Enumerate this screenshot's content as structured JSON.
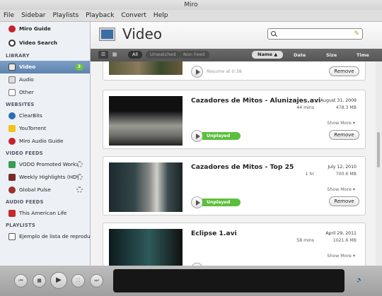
{
  "window": {
    "title": "Miro"
  },
  "menu": [
    "File",
    "Sidebar",
    "Playlists",
    "Playback",
    "Convert",
    "Help"
  ],
  "sidebar": {
    "top": [
      {
        "label": "Miro Guide",
        "icon": "miro-logo-icon"
      },
      {
        "label": "Video Search",
        "icon": "video-search-icon"
      }
    ],
    "library_heading": "LIBRARY",
    "library": [
      {
        "label": "Video",
        "icon": "video-icon",
        "badge": "3",
        "selected": true
      },
      {
        "label": "Audio",
        "icon": "audio-icon"
      },
      {
        "label": "Other",
        "icon": "other-icon"
      }
    ],
    "websites_heading": "WEBSITES",
    "websites": [
      {
        "label": "ClearBits",
        "icon": "clearbits-icon"
      },
      {
        "label": "YouTorrent",
        "icon": "youtorrent-icon"
      },
      {
        "label": "Miro Audio Guide",
        "icon": "miro-logo-icon"
      }
    ],
    "video_feeds_heading": "VIDEO FEEDS",
    "video_feeds": [
      {
        "label": "VODO Promoted Works",
        "icon": "vodo-icon"
      },
      {
        "label": "Weekly Highlights (HD)",
        "icon": "feed-icon"
      },
      {
        "label": "Global Pulse",
        "icon": "feed-icon"
      }
    ],
    "audio_feeds_heading": "AUDIO FEEDS",
    "audio_feeds": [
      {
        "label": "This American Life",
        "icon": "podcast-icon"
      }
    ],
    "playlists_heading": "PLAYLISTS",
    "playlists": [
      {
        "label": "Ejemplo de lista de reproduc",
        "icon": "playlist-icon"
      }
    ]
  },
  "header": {
    "title": "Video",
    "search_placeholder": ""
  },
  "toolbar": {
    "filters": [
      "All",
      "Unwatched",
      "Non Feed"
    ],
    "columns": {
      "name": "Name ▲",
      "date": "Date",
      "size": "Size",
      "time": "Time"
    }
  },
  "items": [
    {
      "title": "",
      "date": "",
      "duration": "",
      "size": "",
      "status": "Resume at 0:38",
      "status_type": "resume",
      "remove": "Remove"
    },
    {
      "title": "Cazadores de Mitos - Alunizajes.avi",
      "date": "August 31, 2009",
      "duration": "44 mins",
      "size": "478.3 MB",
      "show_more": "Show More ▾",
      "status": "Unplayed",
      "status_type": "unplayed",
      "remove": "Remove"
    },
    {
      "title": "Cazadores de Mitos - Top 25",
      "date": "July 12, 2010",
      "duration": "1 hr",
      "size": "700.6 MB",
      "show_more": "Show More ▾",
      "status": "Unplayed",
      "status_type": "unplayed",
      "remove": "Remove"
    },
    {
      "title": "Eclipse 1.avi",
      "date": "April 29, 2011",
      "duration": "58 mins",
      "size": "1021.6 MB",
      "show_more": "Show More ▾"
    }
  ],
  "colors": {
    "selected": "#6a8fba",
    "unplayed": "#5cbf3c",
    "toolbar": "#5f5f5f"
  }
}
